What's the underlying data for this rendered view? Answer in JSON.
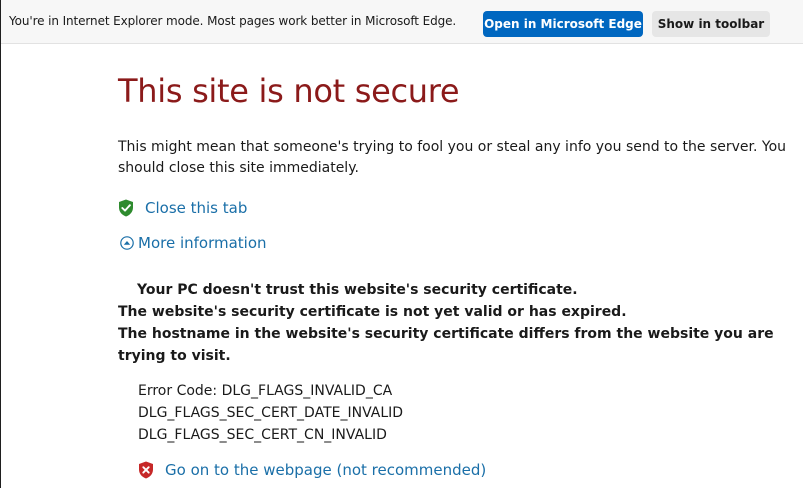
{
  "ie_bar": {
    "message": "You're in Internet Explorer mode. Most pages work better in Microsoft Edge.",
    "open_edge_label": "Open in Microsoft Edge",
    "show_toolbar_label": "Show in toolbar"
  },
  "page": {
    "title": "This site is not secure",
    "description": "This might mean that someone's trying to fool you or steal any info you send to the server. You should close this site immediately.",
    "close_tab_label": "Close this tab",
    "more_info_label": "More information",
    "details": [
      "Your PC doesn't trust this website's security certificate.",
      "The website's security certificate is not yet valid or has expired.",
      "The hostname in the website's security certificate differs from the website you are trying to visit."
    ],
    "error_codes": [
      "Error Code: DLG_FLAGS_INVALID_CA",
      "DLG_FLAGS_SEC_CERT_DATE_INVALID",
      "DLG_FLAGS_SEC_CERT_CN_INVALID"
    ],
    "go_on_label": "Go on to the webpage (not recommended)"
  },
  "colors": {
    "title": "#8b1a1a",
    "link": "#1a6fa8",
    "edge_button": "#0067c0",
    "shield_green": "#2e8b2e",
    "shield_red": "#c62828"
  },
  "icons": {
    "close_tab": "green-shield-check-icon",
    "more_info": "circle-chevron-up-icon",
    "go_on": "red-shield-x-icon"
  }
}
